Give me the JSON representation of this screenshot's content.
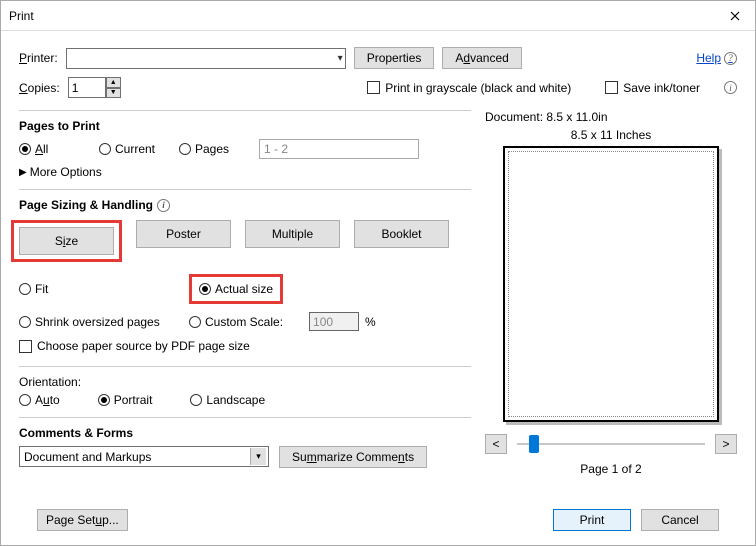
{
  "window": {
    "title": "Print"
  },
  "top": {
    "printer_label_pre": "P",
    "printer_label_rest": "rinter:",
    "properties_btn": "Properties",
    "advanced_btn_pre": "A",
    "advanced_btn_ul": "d",
    "advanced_btn_rest": "vanced",
    "help_label": "Help",
    "copies_label_ul": "C",
    "copies_label_rest": "opies:",
    "copies_value": "1",
    "grayscale_label": "Print in grayscale (black and white)",
    "saveink_label": "Save ink/toner"
  },
  "pages_section": {
    "title": "Pages to Print",
    "all_ul": "A",
    "all_rest": "ll",
    "current": "Current",
    "pages": "Pages",
    "pages_placeholder": "1 - 2",
    "more_options": "More Options"
  },
  "sizing": {
    "title": "Page Sizing & Handling",
    "tabs": {
      "size_pre": "S",
      "size_ul": "i",
      "size_rest": "ze",
      "poster": "Poster",
      "multiple": "Multiple",
      "booklet": "Booklet"
    },
    "fit": "Fit",
    "actual": "Actual size",
    "shrink": "Shrink oversized pages",
    "custom_scale": "Custom Scale:",
    "scale_value": "100",
    "percent": "%",
    "choose_source": "Choose paper source by PDF page size"
  },
  "orientation": {
    "label": "Orientation:",
    "auto_pre": "A",
    "auto_ul": "u",
    "auto_rest": "to",
    "portrait": "Portrait",
    "landscape": "Landscape"
  },
  "comments": {
    "title": "Comments & Forms",
    "combo_value": "Document and Markups",
    "summarize_btn_ul": "m",
    "summarize_btn_pre": "Su",
    "summarize_btn_mid": "marize Comme",
    "summarize_btn_ul2": "n",
    "summarize_btn_end": "ts"
  },
  "preview": {
    "doc_dims": "Document: 8.5 x 11.0in",
    "paper_label": "8.5 x 11 Inches",
    "prev": "<",
    "next": ">",
    "page_of": "Page 1 of 2"
  },
  "footer": {
    "page_setup_pre": "Page Set",
    "page_setup_ul": "u",
    "page_setup_rest": "p...",
    "print": "Print",
    "cancel": "Cancel"
  }
}
